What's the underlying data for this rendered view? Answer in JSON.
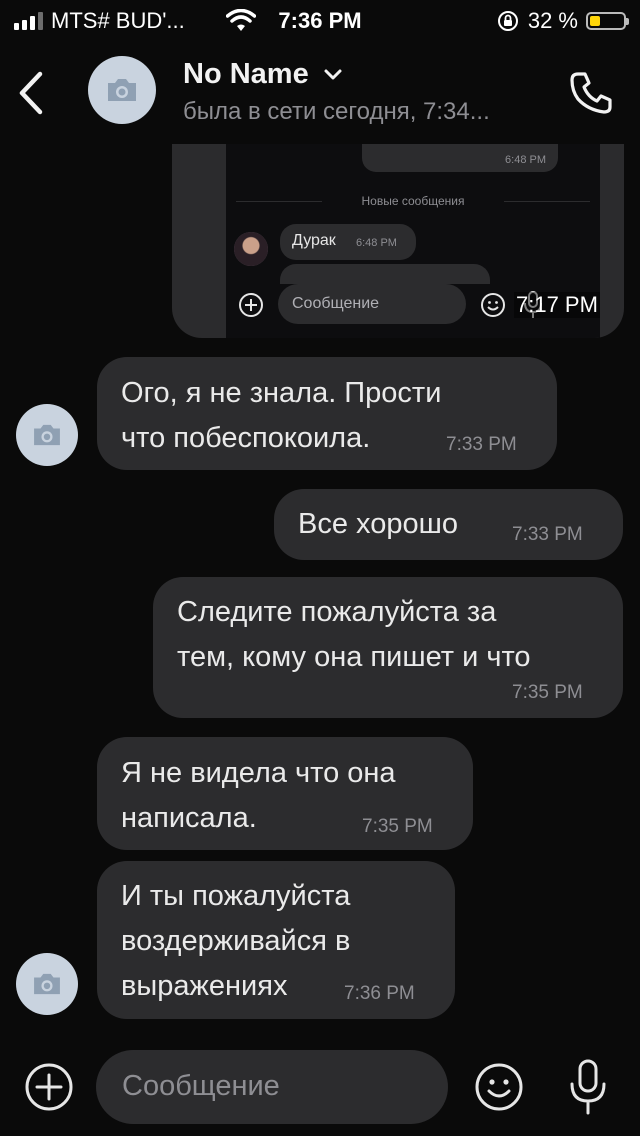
{
  "status_bar": {
    "carrier": "MTS# BUD'...",
    "time": "7:36 PM",
    "battery_percent": "32 %",
    "battery_level": 0.32,
    "icons": [
      "signal-icon",
      "wifi-icon",
      "rotation-lock-icon",
      "battery-icon"
    ]
  },
  "header": {
    "name": "No Name",
    "status": "была в сети сегодня, 7:34...",
    "icons": [
      "back-icon",
      "camera-icon",
      "chevron-down-icon",
      "phone-icon"
    ]
  },
  "embedded_screenshot": {
    "top_bubble_time": "6:48 PM",
    "new_messages_label": "Новые сообщения",
    "message_text": "Дурак",
    "message_time": "6:48 PM",
    "input_placeholder": "Сообщение",
    "overlay_time": "7:17 PM"
  },
  "messages": [
    {
      "direction": "incoming",
      "lines": [
        "Ого, я не знала. Прости",
        "что побеспокоила."
      ],
      "time": "7:33 PM",
      "has_avatar": true
    },
    {
      "direction": "outgoing",
      "lines": [
        "Все хорошо"
      ],
      "time": "7:33 PM"
    },
    {
      "direction": "outgoing",
      "lines": [
        "Следите пожалуйста за",
        "тем, кому она пишет и что"
      ],
      "time": "7:35 PM"
    },
    {
      "direction": "incoming",
      "lines": [
        "Я не видела что она",
        "написала."
      ],
      "time": "7:35 PM",
      "has_avatar": false
    },
    {
      "direction": "incoming",
      "lines": [
        "И ты пожалуйста",
        "воздерживайся в",
        "выражениях"
      ],
      "time": "7:36 PM",
      "has_avatar": true
    }
  ],
  "composer": {
    "placeholder": "Сообщение",
    "icons": [
      "plus-icon",
      "emoji-icon",
      "microphone-icon"
    ]
  },
  "colors": {
    "background": "#0a0a0a",
    "bubble": "#2c2c2e",
    "secondary_text": "#8e8e93",
    "avatar": "#c9d3df",
    "battery_fill": "#ffd60a"
  }
}
